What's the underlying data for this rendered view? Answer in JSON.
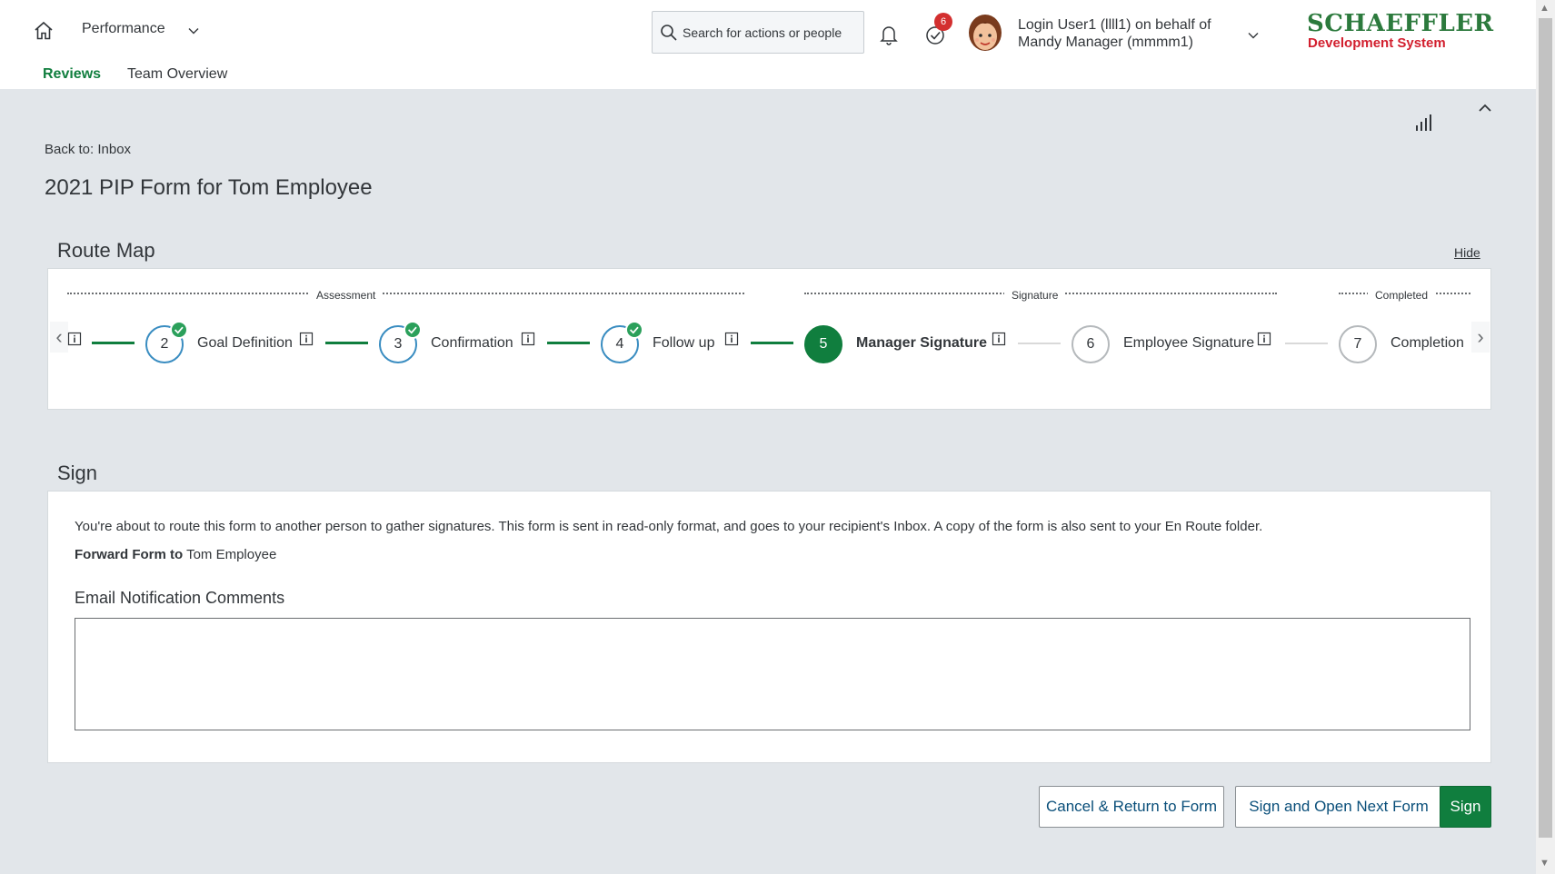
{
  "header": {
    "module": "Performance",
    "search_placeholder": "Search for actions or people",
    "todo_badge": "6",
    "user_line1": "Login User1 (llll1) on behalf of",
    "user_line2": "Mandy Manager (mmmm1)",
    "brand_main": "SCHAEFFLER",
    "brand_sub": "Development System",
    "tabs": [
      {
        "label": "Reviews",
        "active": true
      },
      {
        "label": "Team Overview",
        "active": false
      }
    ]
  },
  "page": {
    "back_link": "Back to: Inbox",
    "title": "2021 PIP Form for Tom Employee"
  },
  "route_map": {
    "title": "Route Map",
    "hide_label": "Hide",
    "groups": [
      "Assessment",
      "Signature",
      "Completed"
    ],
    "steps": [
      {
        "number": "2",
        "label": "Goal Definition",
        "status": "completed"
      },
      {
        "number": "3",
        "label": "Confirmation",
        "status": "completed"
      },
      {
        "number": "4",
        "label": "Follow up",
        "status": "completed"
      },
      {
        "number": "5",
        "label": "Manager Signature",
        "status": "current"
      },
      {
        "number": "6",
        "label": "Employee Signature",
        "status": "pending"
      },
      {
        "number": "7",
        "label": "Completion",
        "status": "pending"
      }
    ]
  },
  "sign": {
    "title": "Sign",
    "description": "You're about to route this form to another person to gather signatures. This form is sent in read-only format, and goes to your recipient's Inbox. A copy of the form is also sent to your En Route folder.",
    "forward_label": "Forward Form to",
    "forward_value": "Tom Employee",
    "email_label": "Email Notification Comments",
    "comment_value": ""
  },
  "buttons": {
    "cancel": "Cancel & Return to Form",
    "sign_next": "Sign and Open Next Form",
    "sign": "Sign"
  },
  "colors": {
    "accent": "#107e3e",
    "step_border": "#3a8dc1",
    "brand_green": "#2c7a3d",
    "brand_red": "#d21f2e",
    "badge": "#d32f2f"
  }
}
